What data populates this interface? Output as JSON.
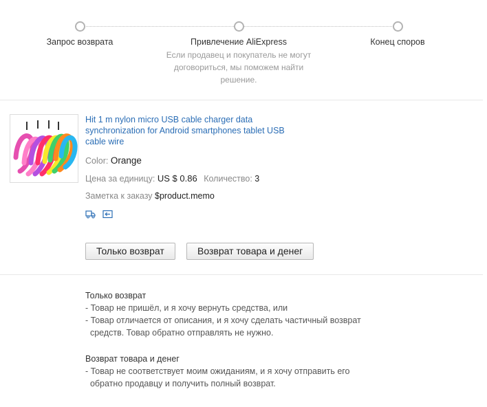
{
  "steps": [
    {
      "label": "Запрос возврата"
    },
    {
      "label": "Привлечение AliExpress",
      "description": "Если продавец и покупатель не могут договориться, мы поможем найти решение."
    },
    {
      "label": "Конец споров"
    }
  ],
  "product": {
    "title": "Hit 1 m nylon micro USB cable charger data synchronization for Android smartphones tablet USB cable wire",
    "color_label": "Color:",
    "color_value": "Orange",
    "price_label": "Цена за единицу:",
    "price_value": "US $ 0.86",
    "quantity_label": "Количество:",
    "quantity_value": "3",
    "memo_label": "Заметка к заказу",
    "memo_value": "$product.memo",
    "icons": [
      "shipping-truck-icon",
      "return-arrow-icon"
    ]
  },
  "buttons": {
    "refund_only": "Только возврат",
    "return_and_refund": "Возврат товара и денег"
  },
  "info": {
    "refund_only": {
      "title": "Только возврат",
      "lines": [
        "- Товар не пришёл, и я хочу вернуть средства, или",
        "- Товар отличается от описания, и я хочу сделать частичный возврат",
        "  средств. Товар обратно отправлять не нужно."
      ]
    },
    "return_and_refund": {
      "title": "Возврат товара и денег",
      "lines": [
        "- Товар не соответствует моим ожиданиям, и я хочу отправить его",
        "  обратно продавцу и получить полный возврат."
      ]
    }
  },
  "colors": {
    "link": "#2a6db5",
    "muted": "#999999",
    "border": "#b7b7b7"
  }
}
